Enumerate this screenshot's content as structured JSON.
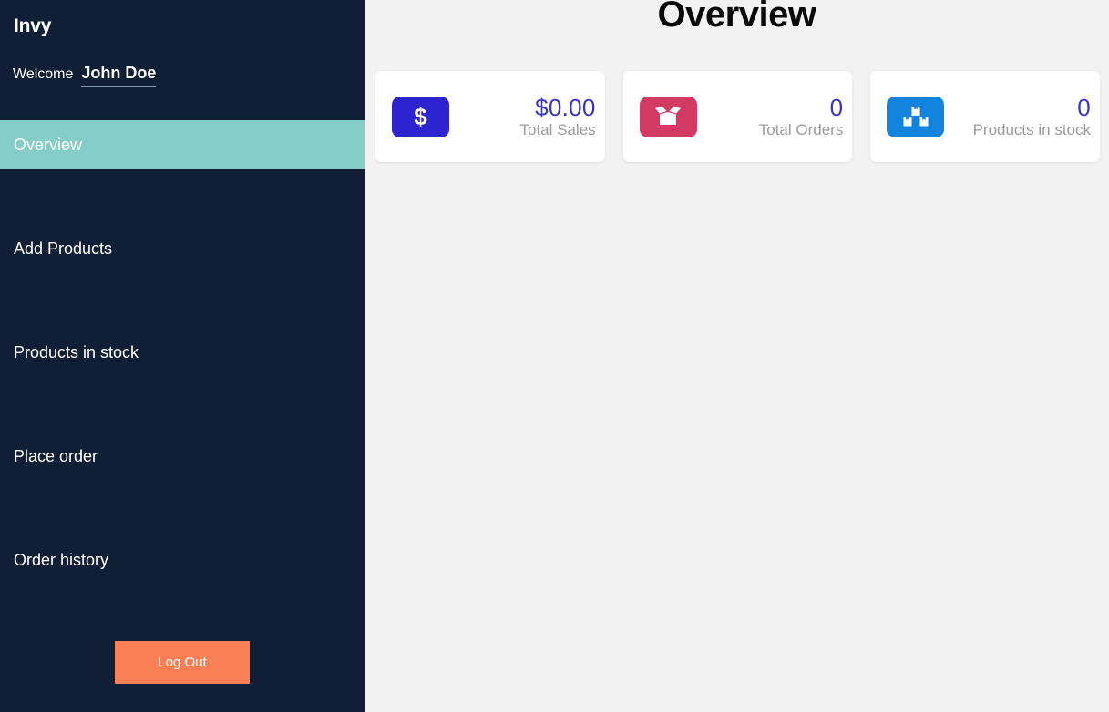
{
  "sidebar": {
    "brand": "Invy",
    "welcome_label": "Welcome",
    "user_name": "John Doe",
    "items": [
      {
        "label": "Overview",
        "name": "overview",
        "active": true
      },
      {
        "label": "Add Products",
        "name": "add-products",
        "active": false
      },
      {
        "label": "Products in stock",
        "name": "products-in-stock",
        "active": false
      },
      {
        "label": "Place order",
        "name": "place-order",
        "active": false
      },
      {
        "label": "Order history",
        "name": "order-history",
        "active": false
      }
    ],
    "logout_label": "Log Out",
    "colors": {
      "background": "#101f35",
      "active_item": "#85cec8",
      "logout_button": "#fa7f55",
      "text": "#ffffff"
    }
  },
  "main": {
    "page_title": "Overview",
    "background": "#f2f2f3",
    "cards": [
      {
        "value": "$0.00",
        "label": "Total Sales",
        "icon": "dollar-sign-icon",
        "icon_bg": "#2d24cf",
        "value_color": "#3b35c4"
      },
      {
        "value": "0",
        "label": "Total Orders",
        "icon": "box-open-icon",
        "icon_bg": "#d23a63",
        "value_color": "#3b35c4"
      },
      {
        "value": "0",
        "label": "Products in stock",
        "icon": "boxes-stacked-icon",
        "icon_bg": "#1284dd",
        "value_color": "#3b35c4"
      }
    ]
  }
}
